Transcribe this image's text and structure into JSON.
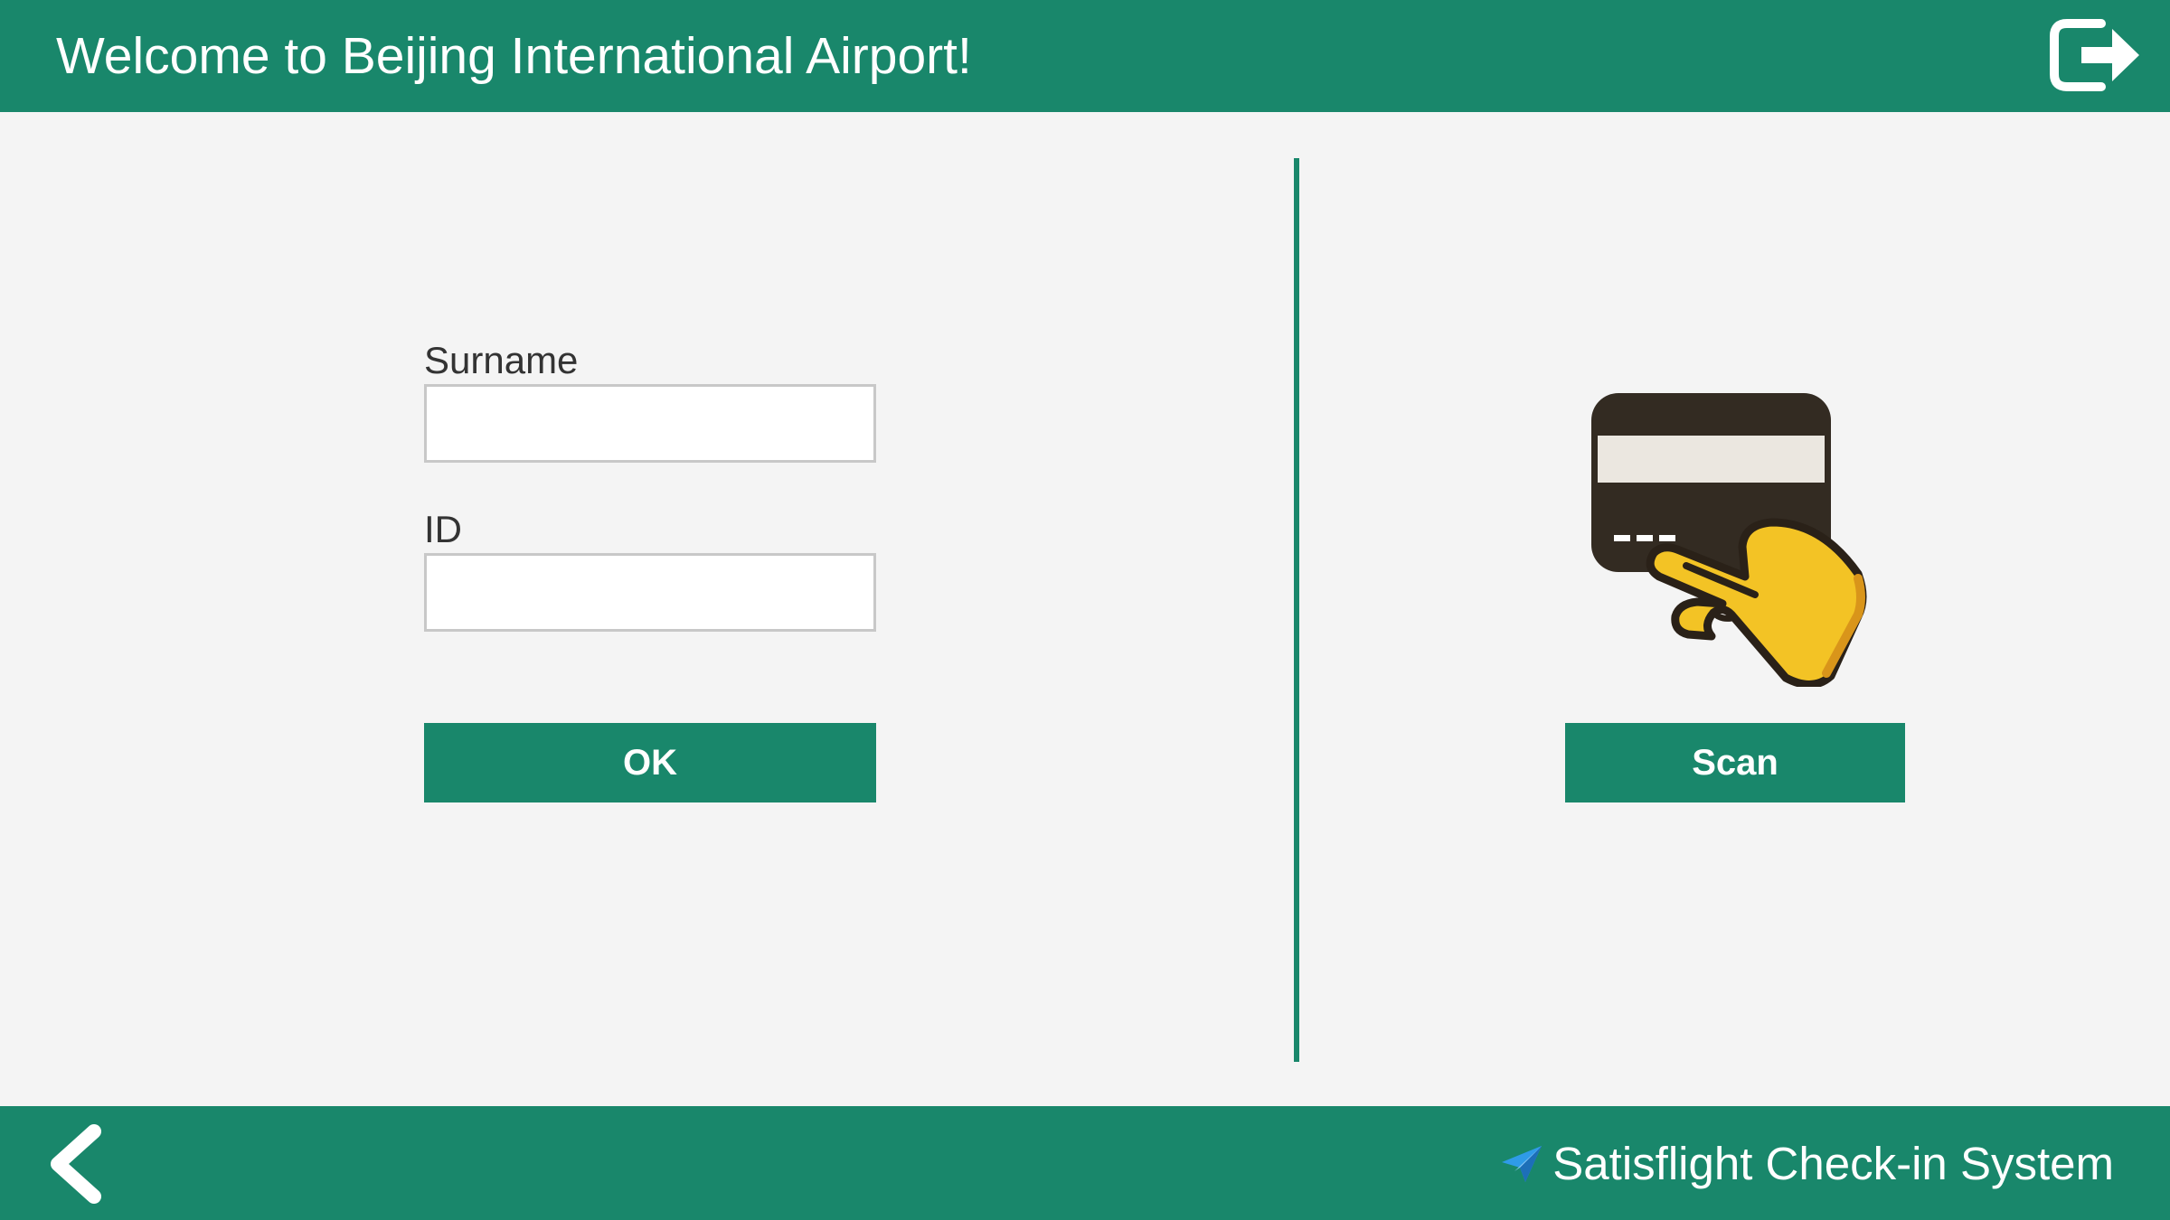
{
  "header": {
    "title": "Welcome to Beijing International Airport!",
    "logout_icon": "logout-icon"
  },
  "form": {
    "surname_label": "Surname",
    "surname_value": "",
    "id_label": "ID",
    "id_value": "",
    "ok_label": "OK"
  },
  "scan": {
    "illustration_icon": "card-in-hand-icon",
    "scan_label": "Scan"
  },
  "footer": {
    "back_icon": "chevron-left-icon",
    "brand_icon": "paper-plane-icon",
    "brand_text": "Satisflight Check-in System"
  },
  "colors": {
    "primary": "#19876b",
    "background": "#f4f4f4",
    "text": "#333333"
  }
}
